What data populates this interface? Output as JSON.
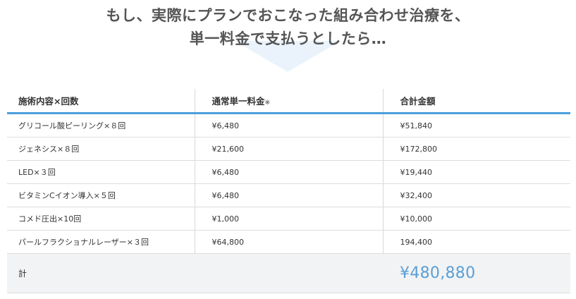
{
  "heading": {
    "line1": "もし、実際にプランでおこなった組み合わせ治療を、",
    "line2": "単一料金で支払うとしたら…"
  },
  "table": {
    "headers": {
      "treatment": "施術内容×回数",
      "unit_price": "通常単一料金",
      "unit_price_note": "※",
      "total": "合計金額"
    },
    "rows": [
      {
        "treatment": "グリコール酸ピーリング×８回",
        "unit_price": "¥6,480",
        "total": "¥51,840"
      },
      {
        "treatment": "ジェネシス×８回",
        "unit_price": "¥21,600",
        "total": "¥172,800"
      },
      {
        "treatment": "LED×３回",
        "unit_price": "¥6,480",
        "total": "¥19,440"
      },
      {
        "treatment": "ビタミンCイオン導入×５回",
        "unit_price": "¥6,480",
        "total": "¥32,400"
      },
      {
        "treatment": "コメド圧出×10回",
        "unit_price": "¥1,000",
        "total": "¥10,000"
      },
      {
        "treatment": "パールフラクショナルレーザー×３回",
        "unit_price": "¥64,800",
        "total": "194,400"
      }
    ],
    "footer": {
      "label": "計",
      "total": "¥480,880"
    }
  },
  "colors": {
    "accent": "#4b9fdd",
    "total_text": "#5a9fd6",
    "footer_bg": "#f2f3f4",
    "arrow": "#eaf3fb"
  }
}
